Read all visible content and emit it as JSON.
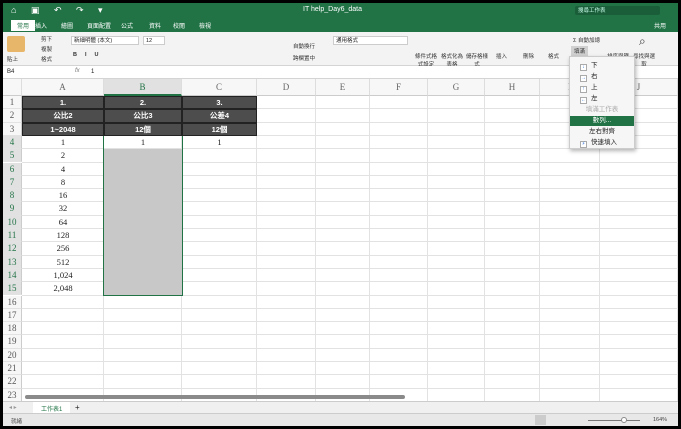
{
  "window": {
    "title": "IT help_Day6_data",
    "search_placeholder": "搜尋工作表",
    "share": "共用"
  },
  "quick_access": "⌂ ▣ ↶ ↷ ▾",
  "ribbon_tabs": [
    "常用",
    "插入",
    "繪圖",
    "頁面配置",
    "公式",
    "資料",
    "校閱",
    "檢視"
  ],
  "ribbon": {
    "paste": "貼上",
    "cut": "剪下",
    "copy": "複製",
    "format_painter": "格式",
    "font_name": "新細明體 (本文)",
    "font_size": "12",
    "wrap": "自動換行",
    "merge": "跨欄置中",
    "number_format": "通用格式",
    "conditional": "條件式格式設定",
    "as_table": "格式化為表格",
    "cell_styles": "儲存格樣式",
    "insert": "插入",
    "delete": "刪除",
    "format": "格式",
    "autosum": "自動加總",
    "fill": "填滿",
    "sort": "排序與篩選",
    "find": "尋找與選取"
  },
  "formula_bar": {
    "name_box": "B4",
    "fx": "fx",
    "value": "1"
  },
  "columns": [
    "A",
    "B",
    "C",
    "D",
    "E",
    "F",
    "G",
    "H",
    "I",
    "J"
  ],
  "rows": [
    "1",
    "2",
    "3",
    "4",
    "5",
    "6",
    "7",
    "8",
    "9",
    "10",
    "11",
    "12",
    "13",
    "14",
    "15",
    "16",
    "17",
    "18",
    "19",
    "20",
    "21",
    "22",
    "23"
  ],
  "header_cells": [
    [
      "1.",
      "2.",
      "3."
    ],
    [
      "公比2",
      "公比3",
      "公差4"
    ],
    [
      "1~2048",
      "12個",
      "12個"
    ]
  ],
  "row4": [
    "1",
    "1",
    "1"
  ],
  "col_a_values": [
    "2",
    "4",
    "8",
    "16",
    "32",
    "64",
    "128",
    "256",
    "512",
    "1,024",
    "2,048"
  ],
  "fill_menu": {
    "items": [
      "下",
      "右",
      "上",
      "左"
    ],
    "disabled": "填滿工作表",
    "selected": "數列...",
    "justify": "左右對齊",
    "flash": "快速填入"
  },
  "sheet_tab": "工作表1",
  "add_sheet": "+",
  "status": {
    "ready": "就緒",
    "zoom": "164%"
  },
  "colors": {
    "accent": "#217346",
    "header_fill": "#4d4d4d",
    "selection_fill": "#c8c8c8"
  }
}
